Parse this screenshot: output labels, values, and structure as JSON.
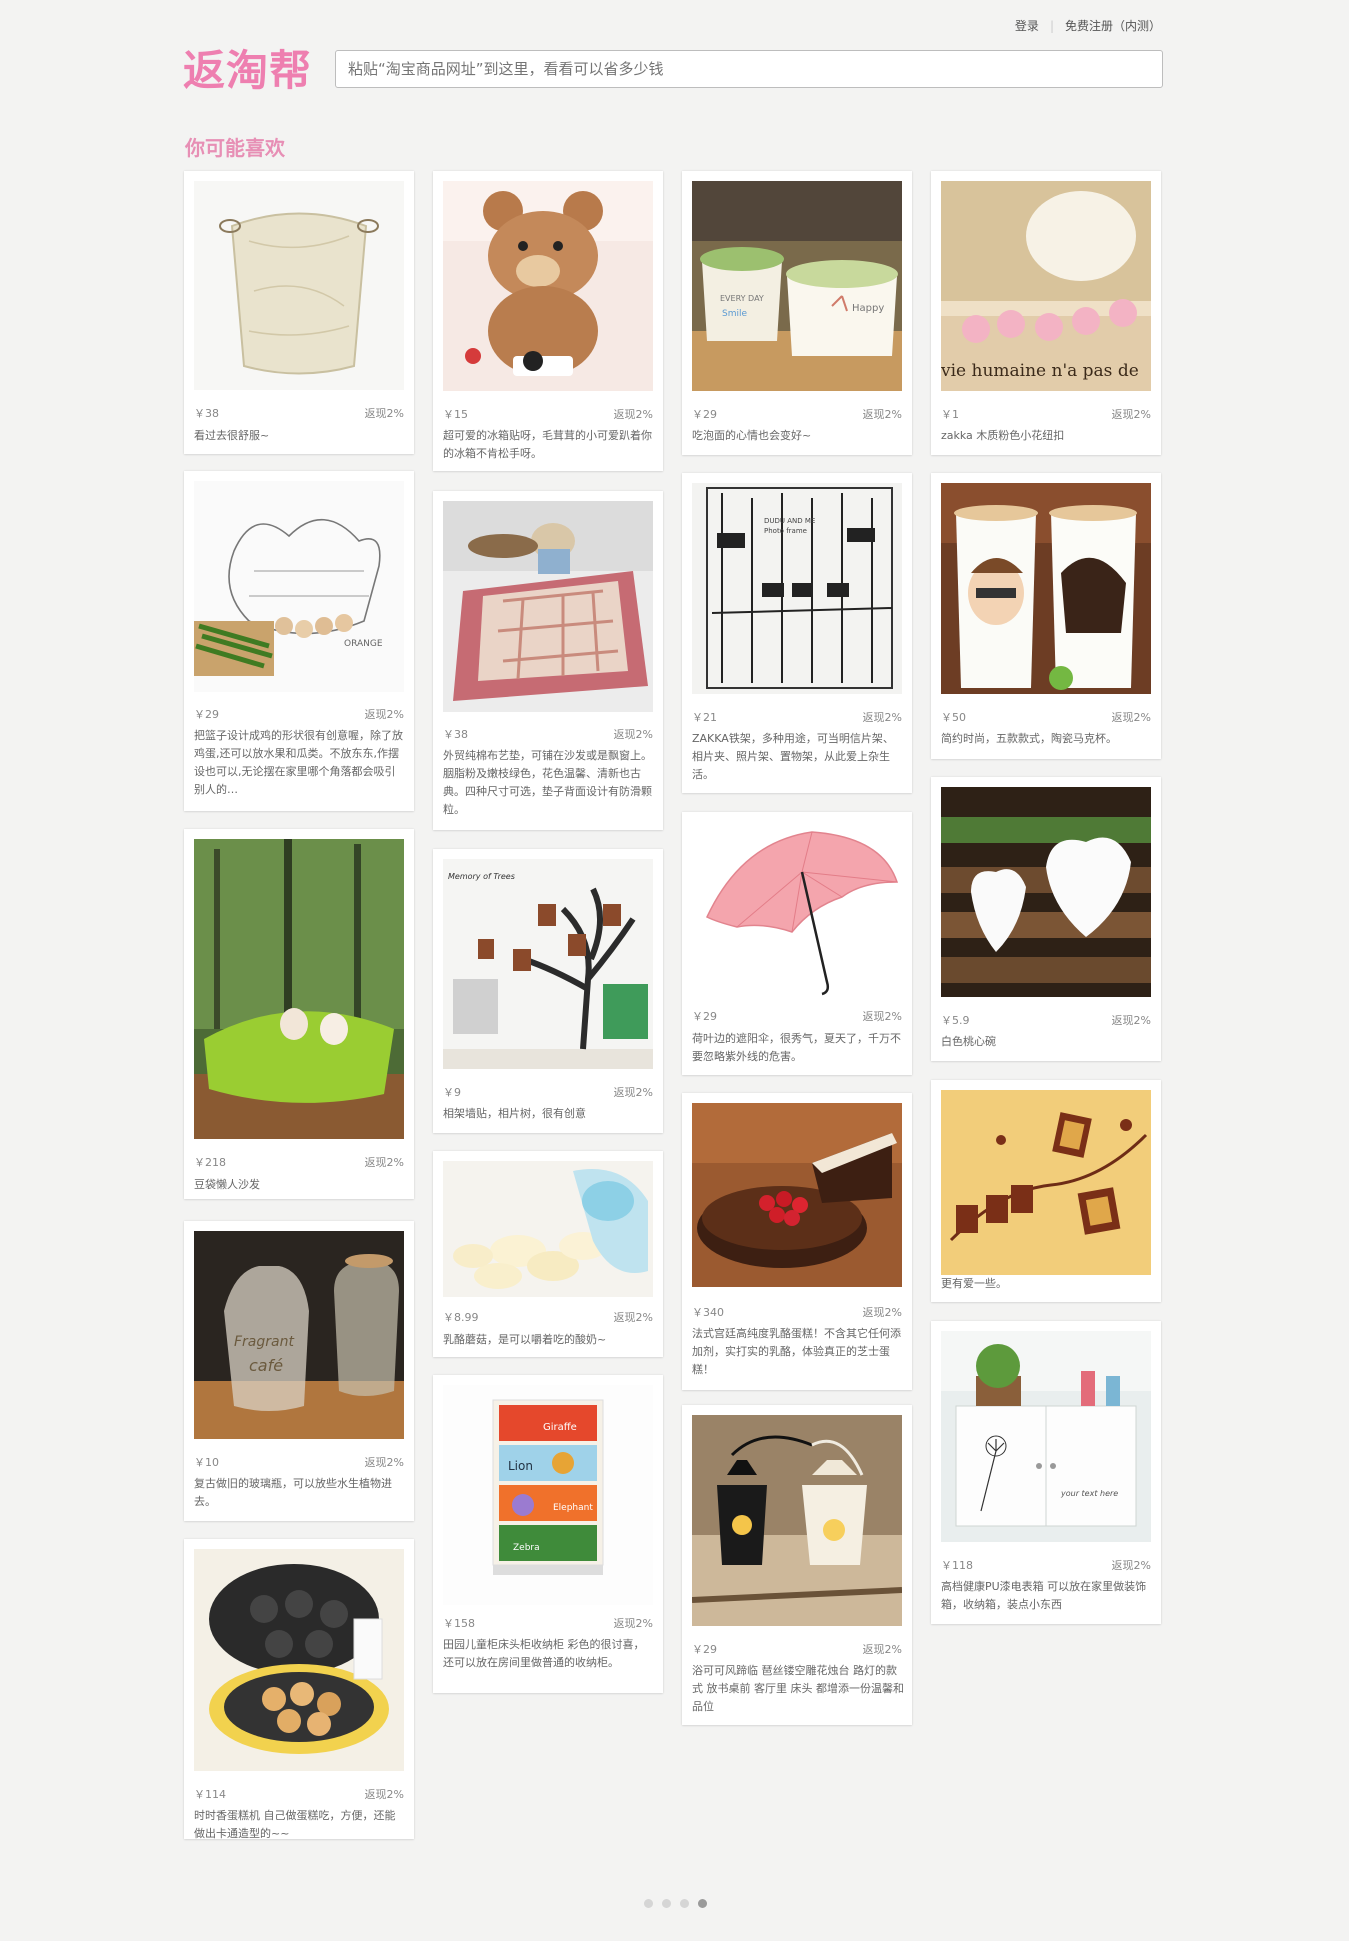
{
  "header": {
    "login": "登录",
    "register": "免费注册（内测）",
    "logo": "返淘帮",
    "search_placeholder": "粘贴“淘宝商品网址”到这里，看看可以省多少钱"
  },
  "section_title": "你可能喜欢",
  "products": [
    {
      "price": "￥38",
      "rebate": "返现2%",
      "desc": "看过去很舒服~",
      "icon": "canvas-basket-image"
    },
    {
      "price": "￥29",
      "rebate": "返现2%",
      "desc": "把篮子设计成鸡的形状很有创意喔，除了放鸡蛋,还可以放水果和瓜类。不放东东,作摆设也可以,无论摆在家里哪个角落都会吸引别人的…",
      "icon": "wire-hen-basket-image"
    },
    {
      "price": "￥218",
      "rebate": "返现2%",
      "desc": "豆袋懒人沙发",
      "icon": "beanbag-sofa-image"
    },
    {
      "price": "￥10",
      "rebate": "返现2%",
      "desc": "复古做旧的玻璃瓶，可以放些水生植物进去。",
      "icon": "glass-bottles-image"
    },
    {
      "price": "￥114",
      "rebate": "返现2%",
      "desc": "时时香蛋糕机 自己做蛋糕吃，方便，还能做出卡通造型的~~",
      "icon": "cake-maker-image"
    },
    {
      "price": "￥15",
      "rebate": "返现2%",
      "desc": "超可爱的冰箱贴呀，毛茸茸的小可爱趴着你的冰箱不肯松手呀。",
      "icon": "teddy-bear-magnet-image"
    },
    {
      "price": "￥38",
      "rebate": "返现2%",
      "desc": "外贸纯棉布艺垫，可铺在沙发或是飘窗上。胭脂粉及嫩枝绿色，花色温馨、清新也古典。四种尺寸可选，垫子背面设计有防滑颗粒。",
      "icon": "quilted-mat-image"
    },
    {
      "price": "￥9",
      "rebate": "返现2%",
      "desc": "相架墙贴，相片树，很有创意",
      "icon": "photo-tree-decal-image"
    },
    {
      "price": "￥8.99",
      "rebate": "返现2%",
      "desc": "乳酪蘑菇，是可以嚼着吃的酸奶~",
      "icon": "cheese-candy-image"
    },
    {
      "price": "￥158",
      "rebate": "返现2%",
      "desc": "田园儿童柜床头柜收纳柜 彩色的很讨喜，还可以放在房间里做普通的收纳柜。",
      "icon": "kids-drawer-cabinet-image"
    },
    {
      "price": "￥29",
      "rebate": "返现2%",
      "desc": "吃泡面的心情也会变好~",
      "icon": "noodle-bowls-image"
    },
    {
      "price": "￥21",
      "rebate": "返现2%",
      "desc": "ZAKKA铁架，多种用途，可当明信片架、相片夹、照片架、置物架，从此爱上杂生活。",
      "icon": "iron-photo-frame-image"
    },
    {
      "price": "￥29",
      "rebate": "返现2%",
      "desc": "荷叶边的遮阳伞，很秀气，夏天了，千万不要忽略紫外线的危害。",
      "icon": "pink-umbrella-image"
    },
    {
      "price": "￥340",
      "rebate": "返现2%",
      "desc": "法式宫廷高纯度乳酪蛋糕！不含其它任何添加剂，实打实的乳酪，体验真正的芝士蛋糕！",
      "icon": "cheesecake-image"
    },
    {
      "price": "￥29",
      "rebate": "返现2%",
      "desc": "浴可可风蹄临 琶丝镂空雕花烛台 路灯的款式 放书桌前 客厅里 床头 都增添一份温馨和品位",
      "icon": "candle-lantern-image"
    },
    {
      "price": "￥1",
      "rebate": "返现2%",
      "desc": "zakka 木质粉色小花纽扣",
      "icon": "pink-flower-buttons-image"
    },
    {
      "price": "￥50",
      "rebate": "返现2%",
      "desc": "简约时尚，五款款式，陶瓷马克杯。",
      "icon": "couple-mugs-image"
    },
    {
      "price": "￥5.9",
      "rebate": "返现2%",
      "desc": "白色桃心碗",
      "icon": "heart-bowls-image"
    },
    {
      "price": "",
      "rebate": "",
      "desc": "更有爱一些。",
      "icon": "wall-frames-decal-image"
    },
    {
      "price": "￥118",
      "rebate": "返现2%",
      "desc": "高档健康PU漆电表箱 可以放在家里做装饰箱，收纳箱，装点小东西",
      "icon": "meter-box-cabinet-image"
    }
  ],
  "pager": {
    "pages": 4,
    "current": 4
  }
}
